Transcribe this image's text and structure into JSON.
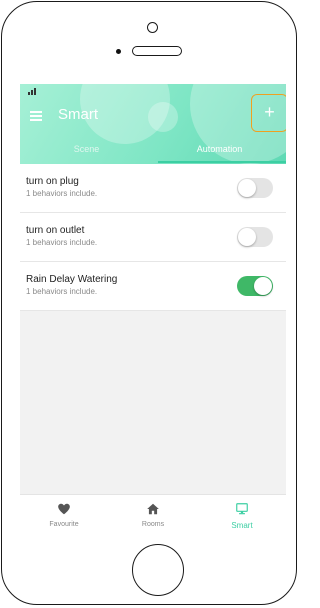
{
  "status_bar": {
    "signal": "▐▐"
  },
  "header": {
    "title": "Smart",
    "add_label": "+",
    "highlight_color": "#f0a020"
  },
  "tabs": [
    {
      "label": "Scene",
      "active": false
    },
    {
      "label": "Automation",
      "active": true
    }
  ],
  "automations": [
    {
      "title": "turn on plug",
      "subtitle": "1 behaviors include.",
      "enabled": false
    },
    {
      "title": "turn on outlet",
      "subtitle": "1 behaviors include.",
      "enabled": false
    },
    {
      "title": "Rain Delay Watering",
      "subtitle": "1 behaviors include.",
      "enabled": true
    }
  ],
  "bottom_nav": [
    {
      "label": "Favourite",
      "icon": "heart-icon",
      "active": false
    },
    {
      "label": "Rooms",
      "icon": "home-icon",
      "active": false
    },
    {
      "label": "Smart",
      "icon": "monitor-icon",
      "active": true
    }
  ],
  "colors": {
    "accent": "#3ccfa3",
    "toggle_on": "#3fb867",
    "toggle_off": "#e4e4e4"
  }
}
